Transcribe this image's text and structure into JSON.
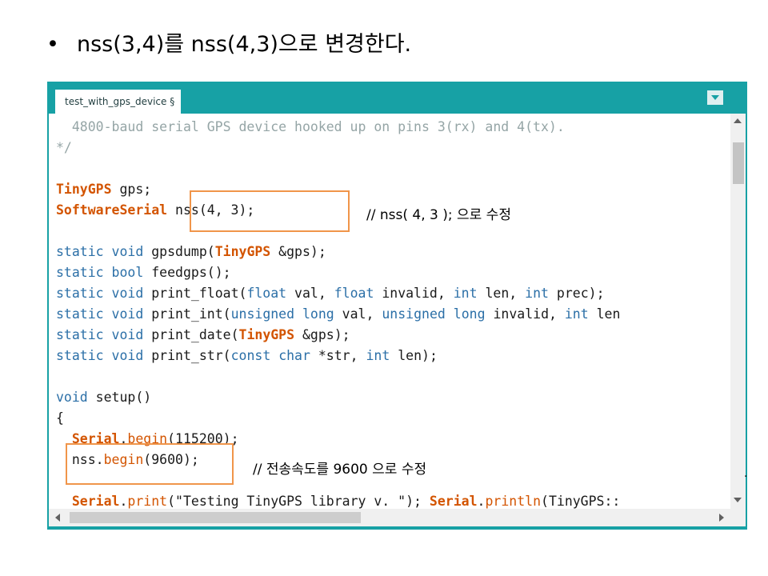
{
  "slide": {
    "bullet": "•",
    "title": "nss(3,4)를 nss(4,3)으로 변경한다."
  },
  "ide": {
    "tab_label": "test_with_gps_device §",
    "tab_menu_icon": "dropdown-triangle-icon",
    "accent_color": "#17a1a5"
  },
  "code_lines": [
    [
      {
        "t": "  4800-baud serial GPS device hooked up on pins 3(rx) and 4(tx).",
        "c": "cm"
      }
    ],
    [
      {
        "t": "*/",
        "c": "cm"
      }
    ],
    [],
    [
      {
        "t": "TinyGPS",
        "c": "ty"
      },
      {
        "t": " gps;"
      }
    ],
    [
      {
        "t": "SoftwareSerial",
        "c": "ty"
      },
      {
        "t": " nss(4, 3);"
      }
    ],
    [],
    [
      {
        "t": "static",
        "c": "kw"
      },
      {
        "t": " "
      },
      {
        "t": "void",
        "c": "kw"
      },
      {
        "t": " gpsdump("
      },
      {
        "t": "TinyGPS",
        "c": "ty"
      },
      {
        "t": " &gps);"
      }
    ],
    [
      {
        "t": "static",
        "c": "kw"
      },
      {
        "t": " "
      },
      {
        "t": "bool",
        "c": "kw"
      },
      {
        "t": " feedgps();"
      }
    ],
    [
      {
        "t": "static",
        "c": "kw"
      },
      {
        "t": " "
      },
      {
        "t": "void",
        "c": "kw"
      },
      {
        "t": " print_float("
      },
      {
        "t": "float",
        "c": "kw"
      },
      {
        "t": " val, "
      },
      {
        "t": "float",
        "c": "kw"
      },
      {
        "t": " invalid, "
      },
      {
        "t": "int",
        "c": "kw"
      },
      {
        "t": " len, "
      },
      {
        "t": "int",
        "c": "kw"
      },
      {
        "t": " prec);"
      }
    ],
    [
      {
        "t": "static",
        "c": "kw"
      },
      {
        "t": " "
      },
      {
        "t": "void",
        "c": "kw"
      },
      {
        "t": " print_int("
      },
      {
        "t": "unsigned",
        "c": "kw"
      },
      {
        "t": " "
      },
      {
        "t": "long",
        "c": "kw"
      },
      {
        "t": " val, "
      },
      {
        "t": "unsigned",
        "c": "kw"
      },
      {
        "t": " "
      },
      {
        "t": "long",
        "c": "kw"
      },
      {
        "t": " invalid, "
      },
      {
        "t": "int",
        "c": "kw"
      },
      {
        "t": " len"
      }
    ],
    [
      {
        "t": "static",
        "c": "kw"
      },
      {
        "t": " "
      },
      {
        "t": "void",
        "c": "kw"
      },
      {
        "t": " print_date("
      },
      {
        "t": "TinyGPS",
        "c": "ty"
      },
      {
        "t": " &gps);"
      }
    ],
    [
      {
        "t": "static",
        "c": "kw"
      },
      {
        "t": " "
      },
      {
        "t": "void",
        "c": "kw"
      },
      {
        "t": " print_str("
      },
      {
        "t": "const",
        "c": "kw"
      },
      {
        "t": " "
      },
      {
        "t": "char",
        "c": "kw"
      },
      {
        "t": " *str, "
      },
      {
        "t": "int",
        "c": "kw"
      },
      {
        "t": " len);"
      }
    ],
    [],
    [
      {
        "t": "void",
        "c": "kw"
      },
      {
        "t": " setup()"
      }
    ],
    [
      {
        "t": "{"
      }
    ],
    [
      {
        "t": "  "
      },
      {
        "t": "Serial",
        "c": "ty"
      },
      {
        "t": "."
      },
      {
        "t": "begin",
        "c": "fn"
      },
      {
        "t": "(115200);"
      }
    ],
    [
      {
        "t": "  nss."
      },
      {
        "t": "begin",
        "c": "fn"
      },
      {
        "t": "(9600);"
      }
    ],
    [
      {
        "t": "  "
      }
    ],
    [
      {
        "t": "  "
      },
      {
        "t": "Serial",
        "c": "ty"
      },
      {
        "t": "."
      },
      {
        "t": "print",
        "c": "fn"
      },
      {
        "t": "(\"Testing TinyGPS library v. \"); "
      },
      {
        "t": "Serial",
        "c": "ty"
      },
      {
        "t": "."
      },
      {
        "t": "println",
        "c": "fn"
      },
      {
        "t": "(TinyGPS::"
      }
    ]
  ],
  "annotations": {
    "note1": "// nss( 4, 3 ); 으로 수정",
    "note2": "// 전송속도를 9600 으로 수정",
    "box_color": "#f0954a"
  }
}
